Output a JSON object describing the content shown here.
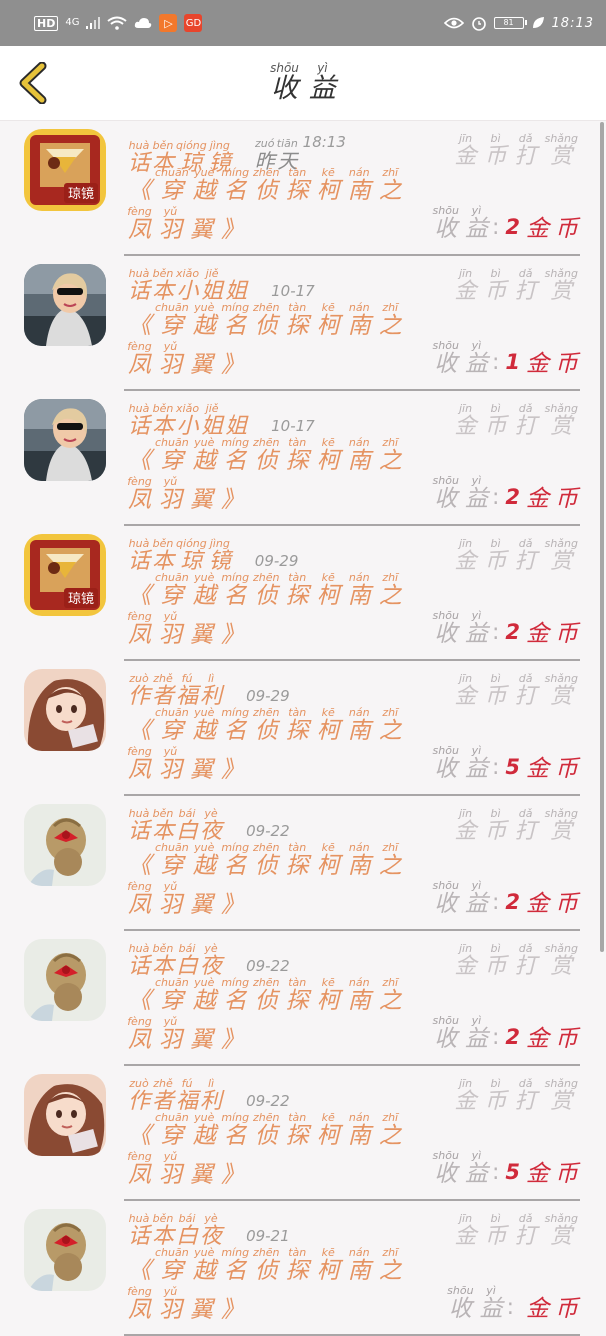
{
  "status_bar": {
    "hd": "HD",
    "network": "4G",
    "app_icon_1": "▷",
    "app_icon_2": "GD",
    "battery_level": "81",
    "time": "18:13"
  },
  "header": {
    "title_chars": [
      {
        "py": "shōu",
        "hz": "收"
      },
      {
        "py": "yì",
        "hz": "益"
      }
    ]
  },
  "labels": {
    "reward": [
      {
        "py": "jīn",
        "hz": "金"
      },
      {
        "py": "bì",
        "hz": "币"
      },
      {
        "py": "dǎ",
        "hz": "打"
      },
      {
        "py": "shǎng",
        "hz": "赏"
      }
    ],
    "earn": [
      {
        "py": "shōu",
        "hz": "收"
      },
      {
        "py": "yì",
        "hz": "益"
      }
    ],
    "colon": ":",
    "currency": [
      {
        "py": "",
        "hz": "金"
      },
      {
        "py": "",
        "hz": "币"
      }
    ],
    "book_title": [
      {
        "py": "",
        "hz": "《"
      },
      {
        "py": "chuān",
        "hz": "穿"
      },
      {
        "py": "yuè",
        "hz": "越"
      },
      {
        "py": "míng",
        "hz": "名"
      },
      {
        "py": "zhēn",
        "hz": "侦"
      },
      {
        "py": "tàn",
        "hz": "探"
      },
      {
        "py": "kē",
        "hz": "柯"
      },
      {
        "py": "nán",
        "hz": "南"
      },
      {
        "py": "zhī",
        "hz": "之"
      },
      {
        "py": "fèng",
        "hz": "凤"
      },
      {
        "py": "yǔ",
        "hz": "羽"
      },
      {
        "py": "",
        "hz": "翼"
      },
      {
        "py": "",
        "hz": "》"
      }
    ]
  },
  "items": [
    {
      "avatar": "mirror-app-avatar",
      "name": [
        {
          "py": "huà",
          "hz": "话"
        },
        {
          "py": "běn",
          "hz": "本"
        },
        {
          "py": "qióng",
          "hz": "琼"
        },
        {
          "py": "jìng",
          "hz": "镜"
        }
      ],
      "date_chars": [
        {
          "py": "zuó",
          "hz": "昨"
        },
        {
          "py": "tiān",
          "hz": "天"
        }
      ],
      "date": "18:13",
      "amount": "2"
    },
    {
      "avatar": "lady-car-avatar",
      "name": [
        {
          "py": "huà",
          "hz": "话"
        },
        {
          "py": "běn",
          "hz": "本"
        },
        {
          "py": "xiǎo",
          "hz": "小"
        },
        {
          "py": "jiě",
          "hz": "姐"
        },
        {
          "py": "",
          "hz": "姐"
        }
      ],
      "date_chars": [],
      "date": "10-17",
      "amount": "1"
    },
    {
      "avatar": "lady-car-avatar",
      "name": [
        {
          "py": "huà",
          "hz": "话"
        },
        {
          "py": "běn",
          "hz": "本"
        },
        {
          "py": "xiǎo",
          "hz": "小"
        },
        {
          "py": "jiě",
          "hz": "姐"
        },
        {
          "py": "",
          "hz": "姐"
        }
      ],
      "date_chars": [],
      "date": "10-17",
      "amount": "2"
    },
    {
      "avatar": "mirror-app-avatar",
      "name": [
        {
          "py": "huà",
          "hz": "话"
        },
        {
          "py": "běn",
          "hz": "本"
        },
        {
          "py": "qióng",
          "hz": "琼"
        },
        {
          "py": "jìng",
          "hz": "镜"
        }
      ],
      "date_chars": [],
      "date": "09-29",
      "amount": "2"
    },
    {
      "avatar": "anime-girl-avatar",
      "name": [
        {
          "py": "zuò",
          "hz": "作"
        },
        {
          "py": "zhě",
          "hz": "者"
        },
        {
          "py": "fú",
          "hz": "福"
        },
        {
          "py": "lì",
          "hz": "利"
        }
      ],
      "date_chars": [],
      "date": "09-29",
      "amount": "5"
    },
    {
      "avatar": "hair-bow-avatar",
      "name": [
        {
          "py": "huà",
          "hz": "话"
        },
        {
          "py": "běn",
          "hz": "本"
        },
        {
          "py": "bái",
          "hz": "白"
        },
        {
          "py": "yè",
          "hz": "夜"
        }
      ],
      "date_chars": [],
      "date": "09-22",
      "amount": "2"
    },
    {
      "avatar": "hair-bow-avatar",
      "name": [
        {
          "py": "huà",
          "hz": "话"
        },
        {
          "py": "běn",
          "hz": "本"
        },
        {
          "py": "bái",
          "hz": "白"
        },
        {
          "py": "yè",
          "hz": "夜"
        }
      ],
      "date_chars": [],
      "date": "09-22",
      "amount": "2"
    },
    {
      "avatar": "anime-girl-avatar",
      "name": [
        {
          "py": "zuò",
          "hz": "作"
        },
        {
          "py": "zhě",
          "hz": "者"
        },
        {
          "py": "fú",
          "hz": "福"
        },
        {
          "py": "lì",
          "hz": "利"
        }
      ],
      "date_chars": [],
      "date": "09-22",
      "amount": "5"
    },
    {
      "avatar": "hair-bow-avatar",
      "name": [
        {
          "py": "huà",
          "hz": "话"
        },
        {
          "py": "běn",
          "hz": "本"
        },
        {
          "py": "bái",
          "hz": "白"
        },
        {
          "py": "yè",
          "hz": "夜"
        }
      ],
      "date_chars": [],
      "date": "09-21",
      "amount": ""
    }
  ],
  "colors": {
    "accent_orange": "#e59361",
    "amount_red": "#d02a3b",
    "back_arrow": "#e6c23a"
  }
}
